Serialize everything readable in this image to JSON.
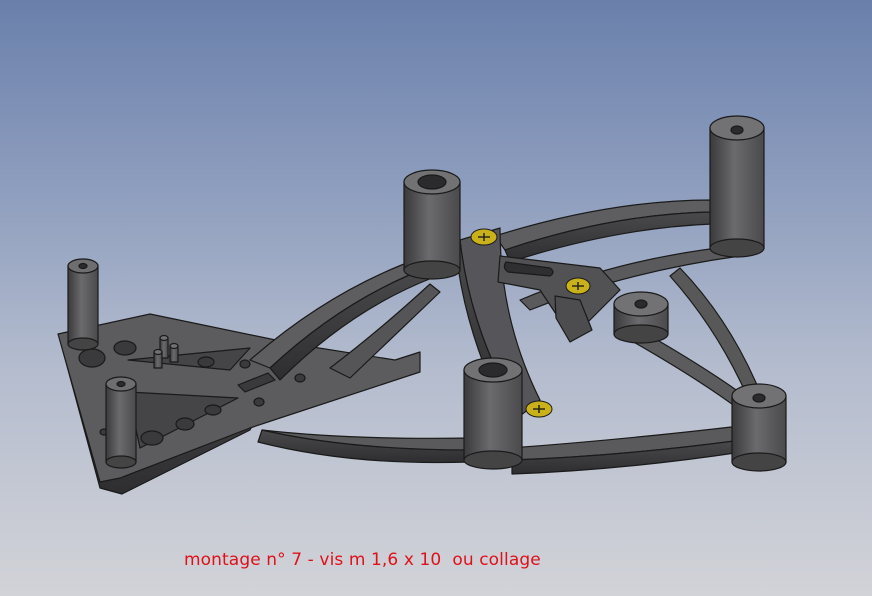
{
  "viewport": {
    "background_top": "#6a80ab",
    "background_bottom": "#d2d3d8"
  },
  "model": {
    "part_color": "#5a5a5c",
    "edge_color": "#1a1a1a",
    "screw_color": "#c8b11a"
  },
  "caption": {
    "text": "montage n° 7 - vis m 1,6 x 10  ou collage",
    "color": "#e0101a"
  }
}
